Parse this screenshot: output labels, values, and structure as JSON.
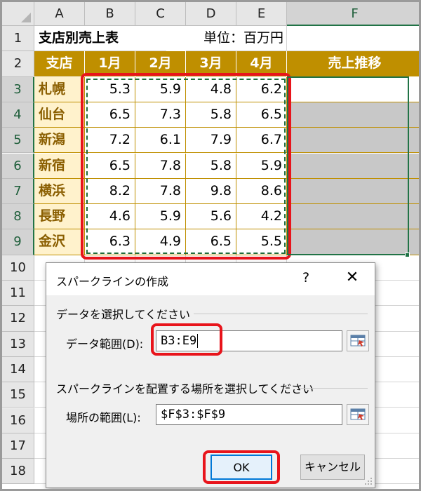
{
  "columns": [
    "A",
    "B",
    "C",
    "D",
    "E",
    "F"
  ],
  "rows": [
    "1",
    "2",
    "3",
    "4",
    "5",
    "6",
    "7",
    "8",
    "9",
    "10",
    "11",
    "12",
    "13",
    "14",
    "15",
    "16",
    "17",
    "18"
  ],
  "title_cell": "支店別売上表",
  "unit_cell": "単位：百万円",
  "header": {
    "branch": "支店",
    "months": [
      "1月",
      "2月",
      "3月",
      "4月"
    ],
    "trend": "売上推移"
  },
  "table": [
    {
      "branch": "札幌",
      "values": [
        "5.3",
        "5.9",
        "4.8",
        "6.2"
      ]
    },
    {
      "branch": "仙台",
      "values": [
        "6.5",
        "7.3",
        "5.8",
        "6.5"
      ]
    },
    {
      "branch": "新潟",
      "values": [
        "7.2",
        "6.1",
        "7.9",
        "6.7"
      ]
    },
    {
      "branch": "新宿",
      "values": [
        "6.5",
        "7.8",
        "5.8",
        "5.9"
      ]
    },
    {
      "branch": "横浜",
      "values": [
        "8.2",
        "7.8",
        "9.8",
        "8.6"
      ]
    },
    {
      "branch": "長野",
      "values": [
        "4.6",
        "5.9",
        "5.6",
        "4.2"
      ]
    },
    {
      "branch": "金沢",
      "values": [
        "6.3",
        "4.9",
        "6.5",
        "5.5"
      ]
    }
  ],
  "dialog": {
    "title": "スパークラインの作成",
    "help": "?",
    "close": "✕",
    "group1_label": "データを選択してください",
    "data_range_label": "データ範囲(D):",
    "data_range_value": "B3:E9",
    "group2_label": "スパークラインを配置する場所を選択してください",
    "location_label": "場所の範囲(L):",
    "location_value": "$F$3:$F$9",
    "ok": "OK",
    "cancel": "キャンセル"
  },
  "colors": {
    "header_gold": "#bf8f00",
    "branch_fill": "#fff2cc",
    "highlight_red": "#e8141b",
    "excel_green": "#217346"
  }
}
